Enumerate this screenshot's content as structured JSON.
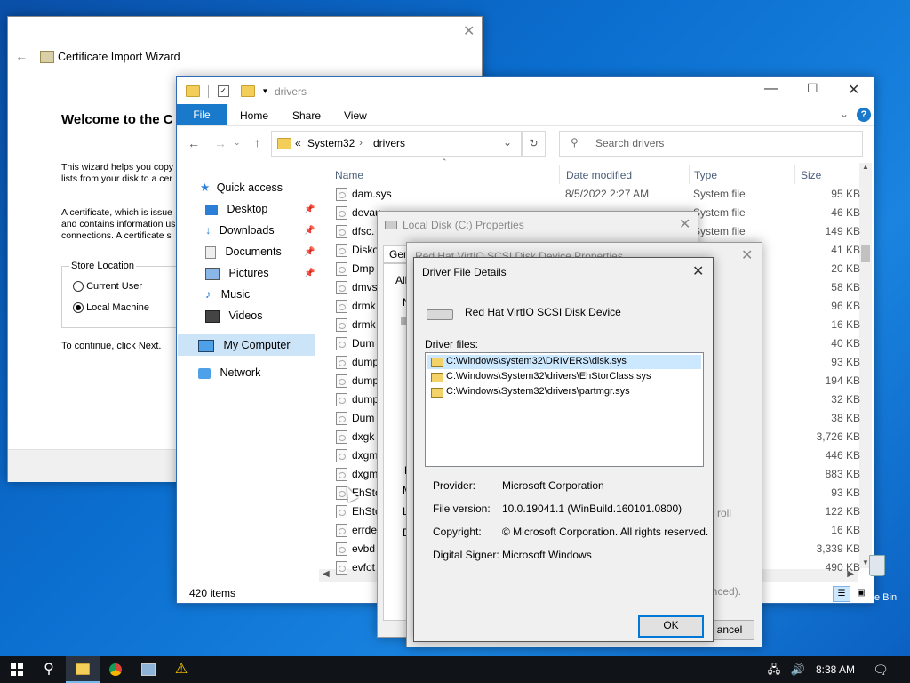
{
  "wizard": {
    "title": "Certificate Import Wizard",
    "heading": "Welcome to the C",
    "intro_line1": "This wizard helps you copy",
    "intro_line2": "lists from your disk to a cer",
    "cert_line1": "A certificate, which is issue",
    "cert_line2": "and contains information us",
    "cert_line3": "connections. A certificate s",
    "store_location_label": "Store Location",
    "options": [
      "Current User",
      "Local Machine"
    ],
    "selected_option": "Local Machine",
    "continue_text": "To continue, click Next."
  },
  "explorer": {
    "title": "drivers",
    "ribbon_tabs": [
      "File",
      "Home",
      "Share",
      "View"
    ],
    "address_prefix": "«",
    "address_parts": [
      "System32",
      "drivers"
    ],
    "search_placeholder": "Search drivers",
    "columns": [
      "Name",
      "Date modified",
      "Type",
      "Size"
    ],
    "nav": {
      "quick_access": "Quick access",
      "items": [
        "Desktop",
        "Downloads",
        "Documents",
        "Pictures",
        "Music",
        "Videos"
      ],
      "my_computer": "My Computer",
      "network": "Network"
    },
    "files": [
      {
        "name": "dam.sys",
        "date": "8/5/2022 2:27 AM",
        "type": "System file",
        "size": "95 KB"
      },
      {
        "name": "devau",
        "date": "",
        "type": "System file",
        "size": "46 KB"
      },
      {
        "name": "dfsc.",
        "date": "",
        "type": "System file",
        "size": "149 KB"
      },
      {
        "name": "Disko",
        "date": "",
        "type": "",
        "size": "41 KB"
      },
      {
        "name": "Dmp",
        "date": "",
        "type": "",
        "size": "20 KB"
      },
      {
        "name": "dmvs",
        "date": "",
        "type": "",
        "size": "58 KB"
      },
      {
        "name": "drmk",
        "date": "",
        "type": "",
        "size": "96 KB"
      },
      {
        "name": "drmk",
        "date": "",
        "type": "",
        "size": "16 KB"
      },
      {
        "name": "Dum",
        "date": "",
        "type": "",
        "size": "40 KB"
      },
      {
        "name": "dump",
        "date": "",
        "type": "",
        "size": "93 KB"
      },
      {
        "name": "dump",
        "date": "",
        "type": "",
        "size": "194 KB"
      },
      {
        "name": "dump",
        "date": "",
        "type": "",
        "size": "32 KB"
      },
      {
        "name": "Dum",
        "date": "",
        "type": "",
        "size": "38 KB"
      },
      {
        "name": "dxgk",
        "date": "",
        "type": "",
        "size": "3,726 KB"
      },
      {
        "name": "dxgm",
        "date": "",
        "type": "",
        "size": "446 KB"
      },
      {
        "name": "dxgm",
        "date": "",
        "type": "",
        "size": "883 KB"
      },
      {
        "name": "EhSto",
        "date": "",
        "type": "",
        "size": "93 KB"
      },
      {
        "name": "EhSto",
        "date": "",
        "type": "",
        "size": "122 KB"
      },
      {
        "name": "errde",
        "date": "",
        "type": "",
        "size": "16 KB"
      },
      {
        "name": "evbd",
        "date": "",
        "type": "",
        "size": "3,339 KB"
      },
      {
        "name": "evfot",
        "date": "",
        "type": "",
        "size": "490 KB"
      }
    ],
    "status": "420 items"
  },
  "local_disk": {
    "title": "Local Disk (C:) Properties",
    "tab": "Gen",
    "frag_all": "All",
    "frag_n": "N",
    "frag_d1": "D",
    "frag_m": "M",
    "frag_l": "L",
    "frag_d2": "D"
  },
  "device_props": {
    "title": "Red Hat VirtIO SCSI Disk Device Properties",
    "frag_roll": "roll",
    "frag_advanced": "anced).",
    "cancel_frag": "ancel"
  },
  "driver_details": {
    "title": "Driver File Details",
    "device_name": "Red Hat VirtIO SCSI Disk Device",
    "files_label": "Driver files:",
    "files": [
      "C:\\Windows\\system32\\DRIVERS\\disk.sys",
      "C:\\Windows\\System32\\drivers\\EhStorClass.sys",
      "C:\\Windows\\System32\\drivers\\partmgr.sys"
    ],
    "provider_label": "Provider:",
    "provider": "Microsoft Corporation",
    "version_label": "File version:",
    "version": "10.0.19041.1 (WinBuild.160101.0800)",
    "copyright_label": "Copyright:",
    "copyright": "© Microsoft Corporation. All rights reserved.",
    "signer_label": "Digital Signer:",
    "signer": "Microsoft Windows",
    "ok": "OK"
  },
  "desktop": {
    "recycle_bin_frag": "e Bin"
  },
  "taskbar": {
    "time": "8:38 AM"
  },
  "colors": {
    "accent": "#0078d7",
    "selection": "#cce8ff",
    "nav_selected": "#cce4f7"
  }
}
